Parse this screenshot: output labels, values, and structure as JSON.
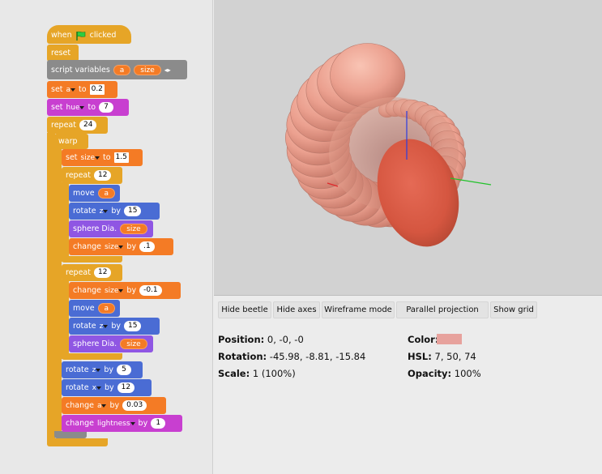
{
  "script": {
    "hat": {
      "when": "when",
      "flag_icon": "green-flag-icon",
      "clicked": "clicked"
    },
    "reset": "reset",
    "script_variables": {
      "label": "script variables",
      "var1": "a",
      "var2": "size"
    },
    "set_a": {
      "set": "set",
      "var": "a",
      "to": "to",
      "value": "0.2"
    },
    "set_hue": {
      "set": "set",
      "var": "hue",
      "to": "to",
      "value": "7"
    },
    "repeat_outer": {
      "label": "repeat",
      "count": "24"
    },
    "warp": "warp",
    "set_size": {
      "set": "set",
      "var": "size",
      "to": "to",
      "value": "1.5"
    },
    "repeat1": {
      "label": "repeat",
      "count": "12"
    },
    "move1": {
      "label": "move",
      "var": "a"
    },
    "rotate1": {
      "label": "rotate",
      "axis": "z",
      "by": "by",
      "value": "15"
    },
    "sphere1": {
      "label": "sphere Dia.",
      "var": "size"
    },
    "change_size1": {
      "label": "change",
      "var": "size",
      "by": "by",
      "value": ".1"
    },
    "repeat2": {
      "label": "repeat",
      "count": "12"
    },
    "change_size2": {
      "label": "change",
      "var": "size",
      "by": "by",
      "value": "-0.1"
    },
    "move2": {
      "label": "move",
      "var": "a"
    },
    "rotate2": {
      "label": "rotate",
      "axis": "z",
      "by": "by",
      "value": "15"
    },
    "sphere2": {
      "label": "sphere Dia.",
      "var": "size"
    },
    "rotate3": {
      "label": "rotate",
      "axis": "z",
      "by": "by",
      "value": "5"
    },
    "rotate4": {
      "label": "rotate",
      "axis": "x",
      "by": "by",
      "value": "12"
    },
    "change_a": {
      "label": "change",
      "var": "a",
      "by": "by",
      "value": "0.03"
    },
    "change_lightness": {
      "label": "change",
      "var": "lightness",
      "by": "by",
      "value": "1"
    }
  },
  "buttons": {
    "hide_beetle": "Hide beetle",
    "hide_axes": "Hide axes",
    "wireframe": "Wireframe mode",
    "parallel": "Parallel projection",
    "show_grid": "Show grid"
  },
  "info": {
    "position_label": "Position:",
    "position_value": "0, -0, -0",
    "rotation_label": "Rotation:",
    "rotation_value": "-45.98, -8.81, -15.84",
    "scale_label": "Scale:",
    "scale_value": "1 (100%)",
    "color_label": "Color:",
    "color_hex": "#e7a29d",
    "hsl_label": "HSL:",
    "hsl_value": "7, 50, 74",
    "opacity_label": "Opacity:",
    "opacity_value": "100%"
  },
  "colors": {
    "control": "#e6a527",
    "variables": "#f47b25",
    "motion": "#4a6cd4",
    "pen": "#c83fd0",
    "beetle": "#8f56e3",
    "shell": "#f0a898"
  }
}
